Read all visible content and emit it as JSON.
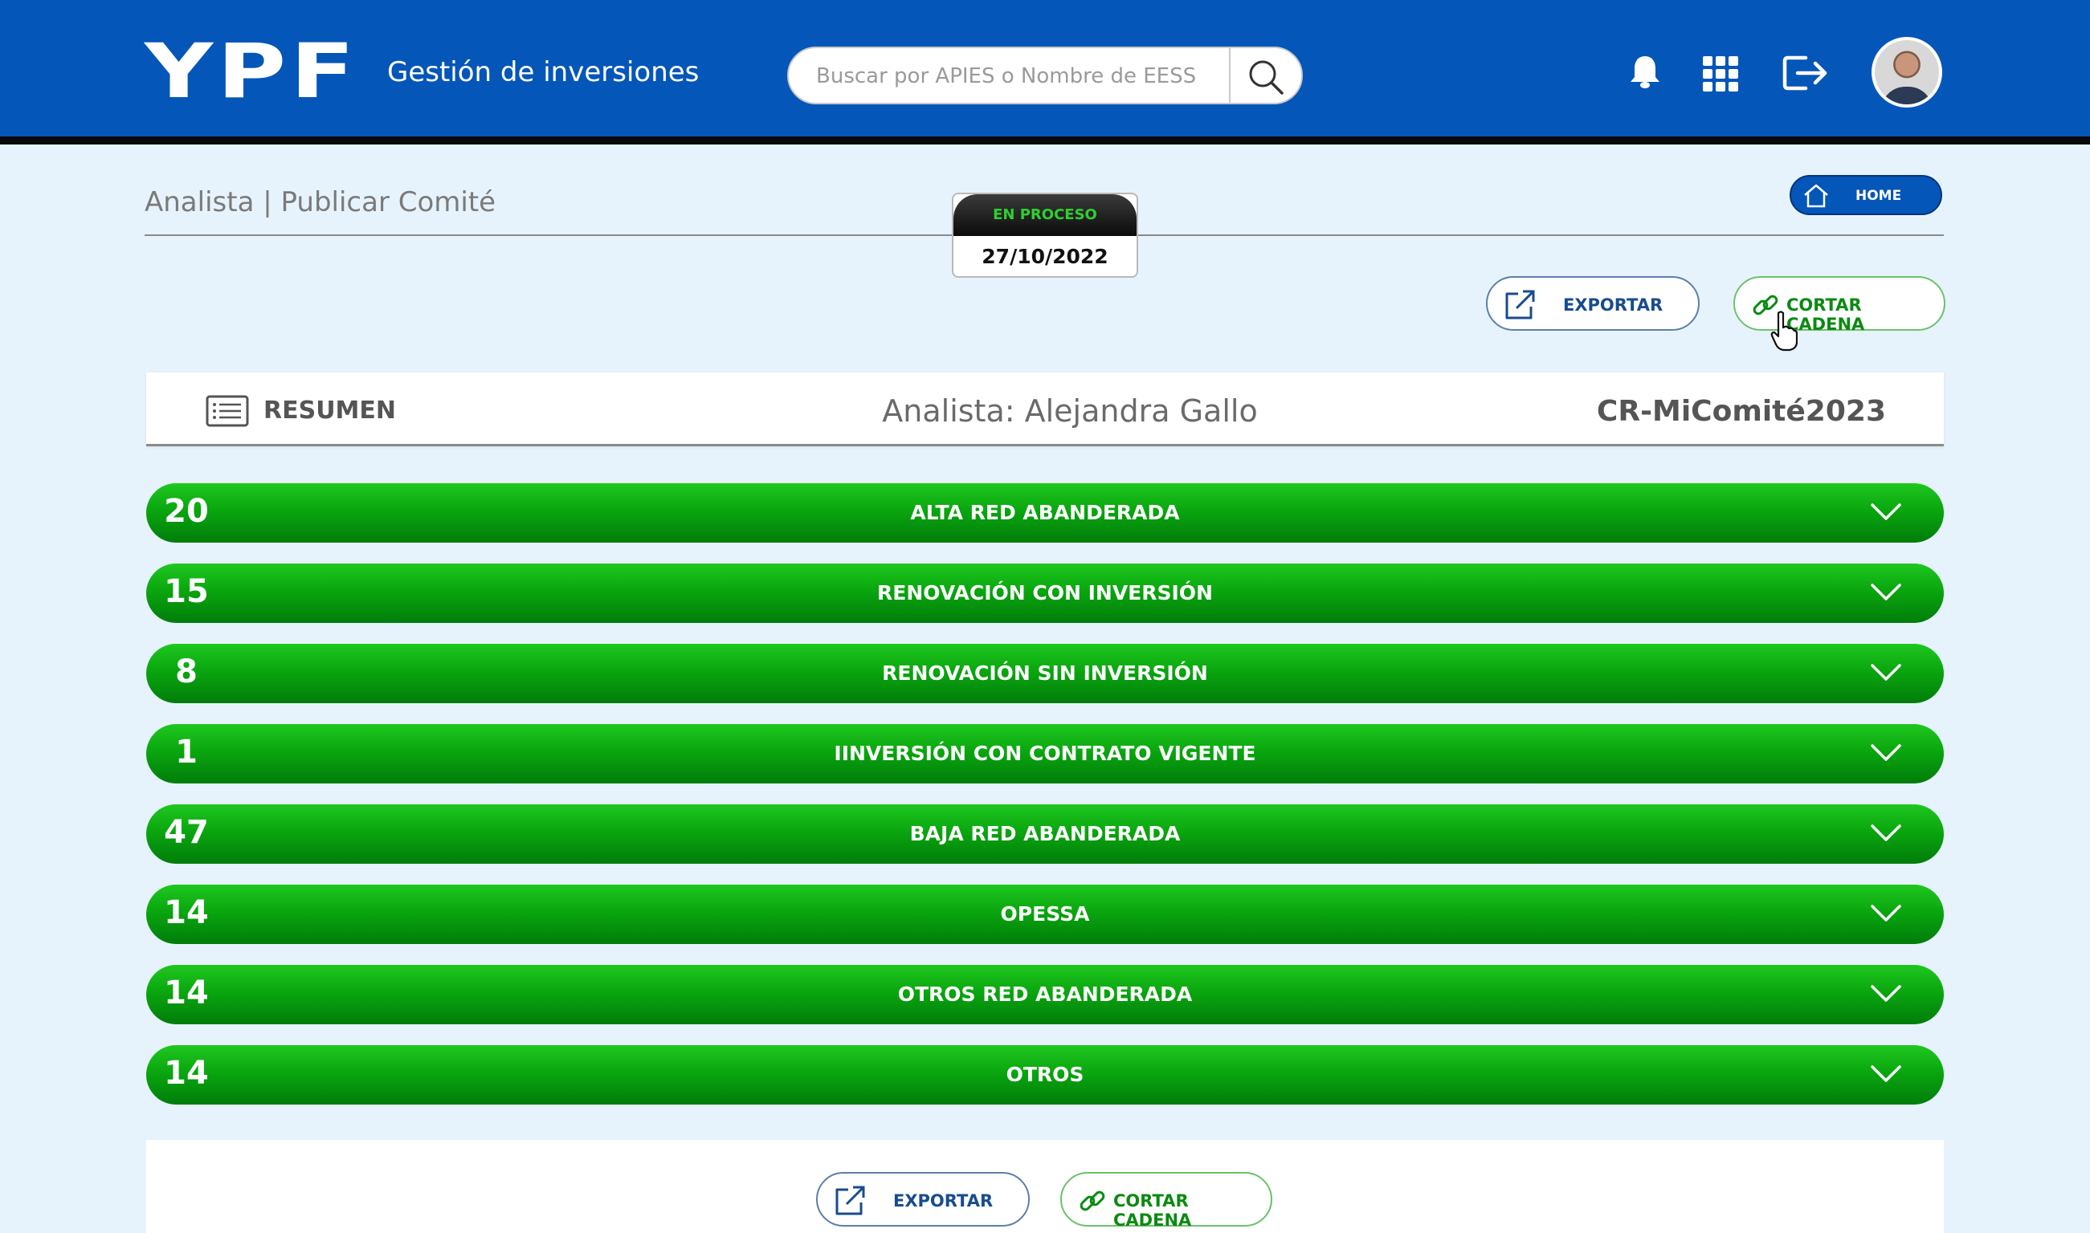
{
  "header": {
    "logo": "YPF",
    "app_title": "Gestión de inversiones",
    "search_placeholder": "Buscar por APIES o Nombre de EESS",
    "icons": [
      "bell-icon",
      "apps-grid-icon",
      "logout-icon"
    ],
    "brand_color": "#0456b9"
  },
  "breadcrumb": "Analista | Publicar Comité",
  "status": {
    "label": "EN PROCESO",
    "date": "27/10/2022",
    "label_color": "#2fd02f"
  },
  "home_button": "HOME",
  "actions": {
    "export_label": "EXPORTAR",
    "cadena_label": "CORTAR CADENA"
  },
  "summary": {
    "title": "RESUMEN",
    "analyst": "Analista: Alejandra Gallo",
    "committee": "CR-MiComité2023"
  },
  "categories": [
    {
      "count": "20",
      "label": "ALTA RED ABANDERADA"
    },
    {
      "count": "15",
      "label": "RENOVACIÓN CON INVERSIÓN"
    },
    {
      "count": "8",
      "label": "RENOVACIÓN SIN INVERSIÓN"
    },
    {
      "count": "1",
      "label": "IINVERSIÓN CON CONTRATO VIGENTE"
    },
    {
      "count": "47",
      "label": "BAJA RED ABANDERADA"
    },
    {
      "count": "14",
      "label": "OPESSA"
    },
    {
      "count": "14",
      "label": "OTROS RED ABANDERADA"
    },
    {
      "count": "14",
      "label": "OTROS"
    }
  ],
  "colors": {
    "category_green": "#0aa60f",
    "background": "#e7f3fc"
  }
}
